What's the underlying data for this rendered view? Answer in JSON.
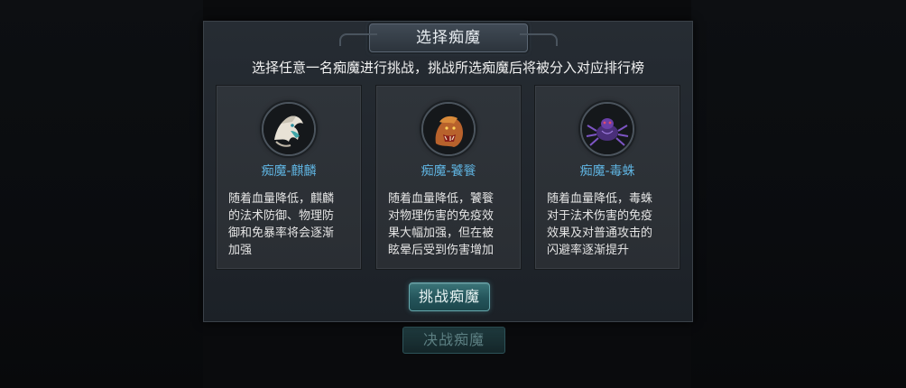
{
  "background_button": {
    "label": "决战痴魔"
  },
  "dialog": {
    "title": "选择痴魔",
    "subtitle": "选择任意一名痴魔进行挑战，挑战所选痴魔后将被分入对应排行榜",
    "cards": [
      {
        "name": "痴魔-麒麟",
        "portrait_icon": "qilin-portrait-icon",
        "description": "随着血量降低，麒麟\n的法术防御、物理防\n御和免暴率将会逐渐\n加强"
      },
      {
        "name": "痴魔-饕餮",
        "portrait_icon": "taotie-portrait-icon",
        "description": "随着血量降低，饕餮\n对物理伤害的免疫效\n果大幅加强，但在被\n眩晕后受到伤害增加"
      },
      {
        "name": "痴魔-毒蛛",
        "portrait_icon": "spider-portrait-icon",
        "description": "随着血量降低，毒蛛\n对于法术伤害的免疫\n效果及对普通攻击的\n闪避率逐渐提升"
      }
    ],
    "challenge_button": {
      "label": "挑战痴魔"
    }
  },
  "colors": {
    "card_title": "#5fb3e0",
    "button_teal": "#24545a",
    "dialog_bg": "#262c33"
  }
}
